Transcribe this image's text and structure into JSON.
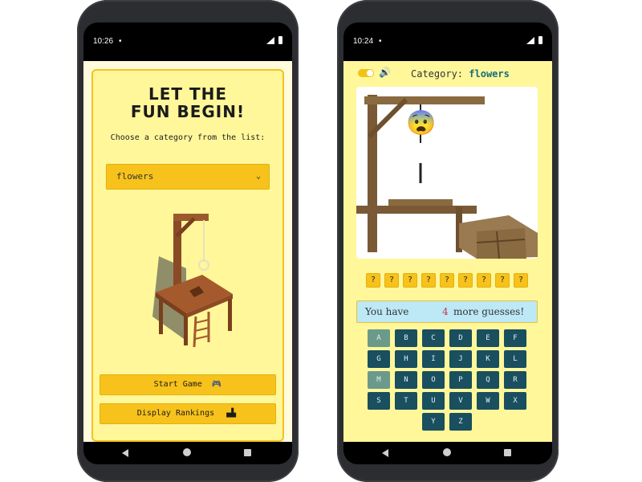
{
  "left_phone": {
    "status": {
      "time": "10:26",
      "dot": "•"
    },
    "title": "LET THE FUN BEGIN!",
    "subtitle": "Choose a category from the list:",
    "category_select": {
      "value": "flowers"
    },
    "start_button": {
      "label": "Start Game"
    },
    "rankings_button": {
      "label": "Display Rankings"
    }
  },
  "right_phone": {
    "status": {
      "time": "10:24",
      "dot": "•"
    },
    "category_label": "Category:",
    "category_value": "flowers",
    "toggle_state": "on",
    "face_emoji": "😨",
    "hidden_letters": [
      "?",
      "?",
      "?",
      "?",
      "?",
      "?",
      "?",
      "?",
      "?"
    ],
    "guesses_prefix": "You have",
    "guesses_count": "4",
    "guesses_suffix": "more guesses!",
    "keys": [
      {
        "letter": "A",
        "used": true
      },
      {
        "letter": "B",
        "used": false
      },
      {
        "letter": "C",
        "used": false
      },
      {
        "letter": "D",
        "used": false
      },
      {
        "letter": "E",
        "used": false
      },
      {
        "letter": "F",
        "used": false
      },
      {
        "letter": "G",
        "used": false
      },
      {
        "letter": "H",
        "used": false
      },
      {
        "letter": "I",
        "used": false
      },
      {
        "letter": "J",
        "used": false
      },
      {
        "letter": "K",
        "used": false
      },
      {
        "letter": "L",
        "used": false
      },
      {
        "letter": "M",
        "used": true
      },
      {
        "letter": "N",
        "used": false
      },
      {
        "letter": "O",
        "used": false
      },
      {
        "letter": "P",
        "used": false
      },
      {
        "letter": "Q",
        "used": false
      },
      {
        "letter": "R",
        "used": false
      },
      {
        "letter": "S",
        "used": false
      },
      {
        "letter": "T",
        "used": false
      },
      {
        "letter": "U",
        "used": false
      },
      {
        "letter": "V",
        "used": false
      },
      {
        "letter": "W",
        "used": false
      },
      {
        "letter": "X",
        "used": false
      },
      {
        "letter": "Y",
        "used": false
      },
      {
        "letter": "Z",
        "used": false
      }
    ]
  },
  "colors": {
    "accent_yellow": "#f7c21b",
    "card_yellow": "#fff79a",
    "key_teal": "#194f5f",
    "key_used": "#6b9a8a",
    "guess_bg": "#bde8f5",
    "guess_count": "#c4334b",
    "category_value": "#176c7e"
  }
}
